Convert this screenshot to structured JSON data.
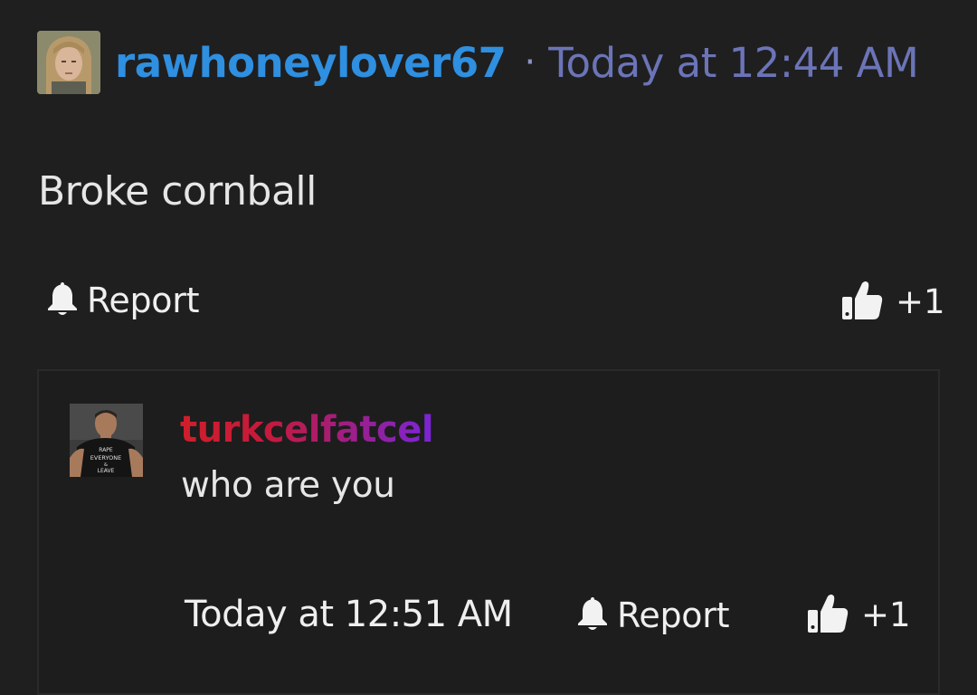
{
  "post": {
    "author": "rawhoneylover67",
    "separator": "·",
    "timestamp": "Today at 12:44 AM",
    "body": "Broke cornball",
    "actions": {
      "report_label": "Report",
      "like_count": "+1"
    }
  },
  "reply": {
    "author": "turkcelfatcel",
    "body": "who are you",
    "timestamp": "Today at 12:51 AM",
    "actions": {
      "report_label": "Report",
      "like_count": "+1"
    },
    "avatar_shirt_text": [
      "RAPE",
      "EVERYONE",
      "&",
      "LEAVE"
    ]
  },
  "colors": {
    "background": "#1f1f1f",
    "author_main": "#2f8fe0",
    "timestamp_main": "#6c74b8",
    "author_reply_gradient": [
      "#d01e2a",
      "#7a25d8"
    ],
    "text": "#e6e6e6"
  },
  "icons": {
    "report": "bell-icon",
    "like": "thumbs-up-icon"
  }
}
